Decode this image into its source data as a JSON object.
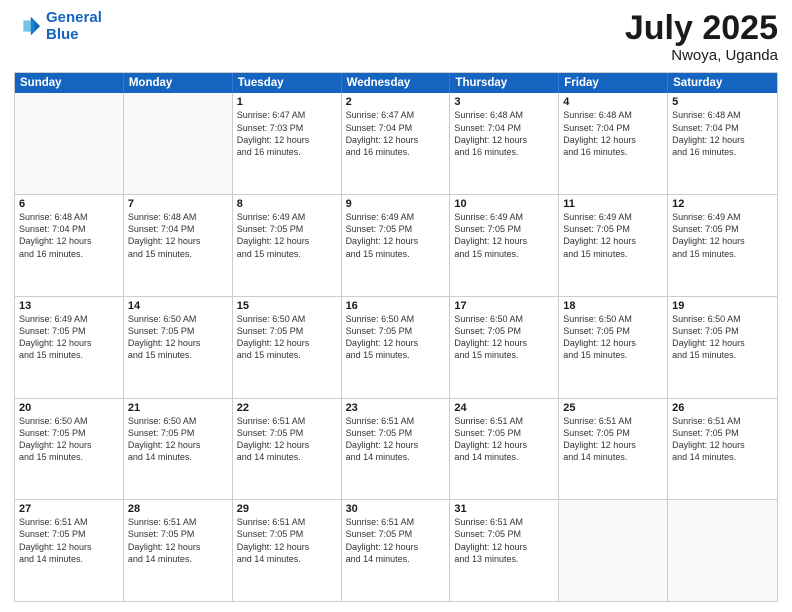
{
  "header": {
    "logo_line1": "General",
    "logo_line2": "Blue",
    "month": "July 2025",
    "location": "Nwoya, Uganda"
  },
  "weekdays": [
    "Sunday",
    "Monday",
    "Tuesday",
    "Wednesday",
    "Thursday",
    "Friday",
    "Saturday"
  ],
  "weeks": [
    [
      {
        "day": "",
        "info": ""
      },
      {
        "day": "",
        "info": ""
      },
      {
        "day": "1",
        "info": "Sunrise: 6:47 AM\nSunset: 7:03 PM\nDaylight: 12 hours\nand 16 minutes."
      },
      {
        "day": "2",
        "info": "Sunrise: 6:47 AM\nSunset: 7:04 PM\nDaylight: 12 hours\nand 16 minutes."
      },
      {
        "day": "3",
        "info": "Sunrise: 6:48 AM\nSunset: 7:04 PM\nDaylight: 12 hours\nand 16 minutes."
      },
      {
        "day": "4",
        "info": "Sunrise: 6:48 AM\nSunset: 7:04 PM\nDaylight: 12 hours\nand 16 minutes."
      },
      {
        "day": "5",
        "info": "Sunrise: 6:48 AM\nSunset: 7:04 PM\nDaylight: 12 hours\nand 16 minutes."
      }
    ],
    [
      {
        "day": "6",
        "info": "Sunrise: 6:48 AM\nSunset: 7:04 PM\nDaylight: 12 hours\nand 16 minutes."
      },
      {
        "day": "7",
        "info": "Sunrise: 6:48 AM\nSunset: 7:04 PM\nDaylight: 12 hours\nand 15 minutes."
      },
      {
        "day": "8",
        "info": "Sunrise: 6:49 AM\nSunset: 7:05 PM\nDaylight: 12 hours\nand 15 minutes."
      },
      {
        "day": "9",
        "info": "Sunrise: 6:49 AM\nSunset: 7:05 PM\nDaylight: 12 hours\nand 15 minutes."
      },
      {
        "day": "10",
        "info": "Sunrise: 6:49 AM\nSunset: 7:05 PM\nDaylight: 12 hours\nand 15 minutes."
      },
      {
        "day": "11",
        "info": "Sunrise: 6:49 AM\nSunset: 7:05 PM\nDaylight: 12 hours\nand 15 minutes."
      },
      {
        "day": "12",
        "info": "Sunrise: 6:49 AM\nSunset: 7:05 PM\nDaylight: 12 hours\nand 15 minutes."
      }
    ],
    [
      {
        "day": "13",
        "info": "Sunrise: 6:49 AM\nSunset: 7:05 PM\nDaylight: 12 hours\nand 15 minutes."
      },
      {
        "day": "14",
        "info": "Sunrise: 6:50 AM\nSunset: 7:05 PM\nDaylight: 12 hours\nand 15 minutes."
      },
      {
        "day": "15",
        "info": "Sunrise: 6:50 AM\nSunset: 7:05 PM\nDaylight: 12 hours\nand 15 minutes."
      },
      {
        "day": "16",
        "info": "Sunrise: 6:50 AM\nSunset: 7:05 PM\nDaylight: 12 hours\nand 15 minutes."
      },
      {
        "day": "17",
        "info": "Sunrise: 6:50 AM\nSunset: 7:05 PM\nDaylight: 12 hours\nand 15 minutes."
      },
      {
        "day": "18",
        "info": "Sunrise: 6:50 AM\nSunset: 7:05 PM\nDaylight: 12 hours\nand 15 minutes."
      },
      {
        "day": "19",
        "info": "Sunrise: 6:50 AM\nSunset: 7:05 PM\nDaylight: 12 hours\nand 15 minutes."
      }
    ],
    [
      {
        "day": "20",
        "info": "Sunrise: 6:50 AM\nSunset: 7:05 PM\nDaylight: 12 hours\nand 15 minutes."
      },
      {
        "day": "21",
        "info": "Sunrise: 6:50 AM\nSunset: 7:05 PM\nDaylight: 12 hours\nand 14 minutes."
      },
      {
        "day": "22",
        "info": "Sunrise: 6:51 AM\nSunset: 7:05 PM\nDaylight: 12 hours\nand 14 minutes."
      },
      {
        "day": "23",
        "info": "Sunrise: 6:51 AM\nSunset: 7:05 PM\nDaylight: 12 hours\nand 14 minutes."
      },
      {
        "day": "24",
        "info": "Sunrise: 6:51 AM\nSunset: 7:05 PM\nDaylight: 12 hours\nand 14 minutes."
      },
      {
        "day": "25",
        "info": "Sunrise: 6:51 AM\nSunset: 7:05 PM\nDaylight: 12 hours\nand 14 minutes."
      },
      {
        "day": "26",
        "info": "Sunrise: 6:51 AM\nSunset: 7:05 PM\nDaylight: 12 hours\nand 14 minutes."
      }
    ],
    [
      {
        "day": "27",
        "info": "Sunrise: 6:51 AM\nSunset: 7:05 PM\nDaylight: 12 hours\nand 14 minutes."
      },
      {
        "day": "28",
        "info": "Sunrise: 6:51 AM\nSunset: 7:05 PM\nDaylight: 12 hours\nand 14 minutes."
      },
      {
        "day": "29",
        "info": "Sunrise: 6:51 AM\nSunset: 7:05 PM\nDaylight: 12 hours\nand 14 minutes."
      },
      {
        "day": "30",
        "info": "Sunrise: 6:51 AM\nSunset: 7:05 PM\nDaylight: 12 hours\nand 14 minutes."
      },
      {
        "day": "31",
        "info": "Sunrise: 6:51 AM\nSunset: 7:05 PM\nDaylight: 12 hours\nand 13 minutes."
      },
      {
        "day": "",
        "info": ""
      },
      {
        "day": "",
        "info": ""
      }
    ]
  ]
}
